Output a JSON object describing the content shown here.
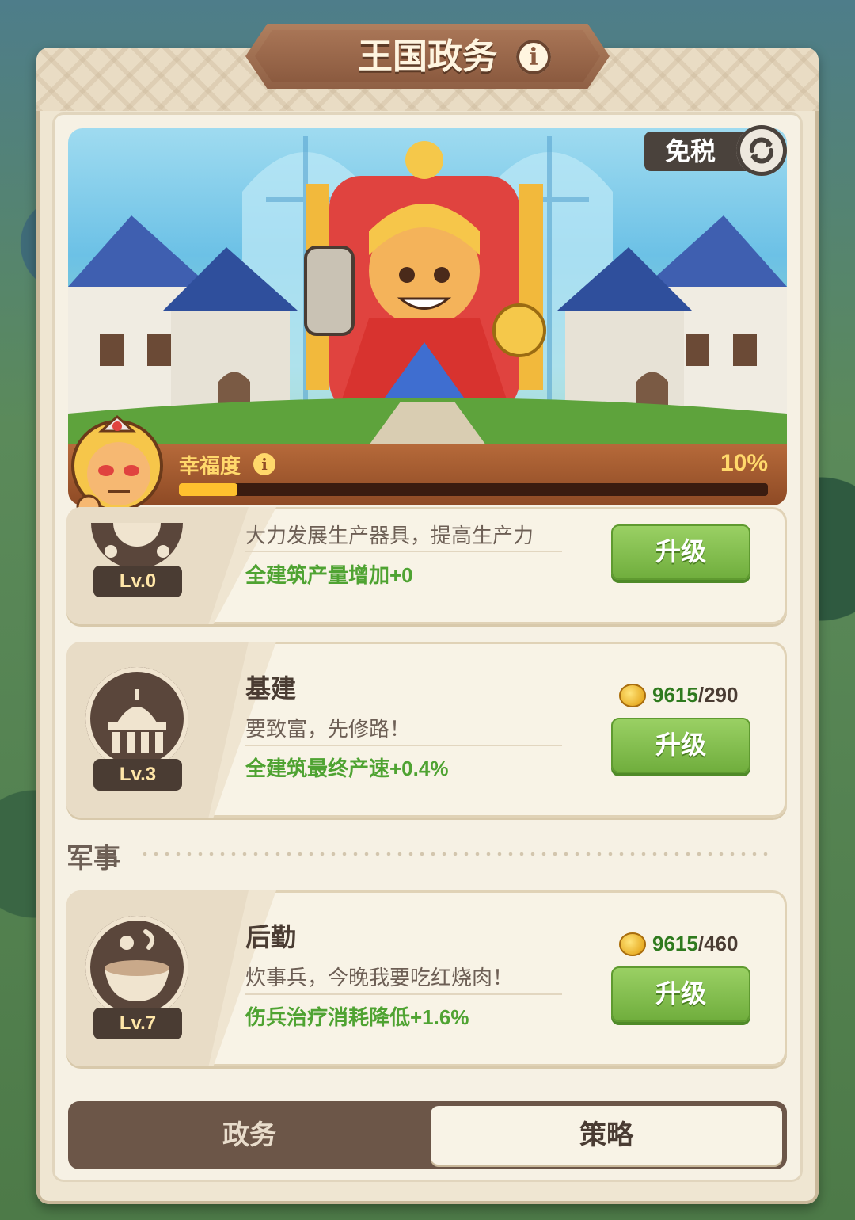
{
  "header": {
    "title": "王国政务",
    "info_icon": "info-icon"
  },
  "banner": {
    "tax_free_label": "免税",
    "refresh_icon": "refresh-icon",
    "happiness_label": "幸福度",
    "happiness_percent_text": "10%",
    "happiness_fraction": 0.1
  },
  "cards": [
    {
      "level": "Lv.0",
      "icon": "gear-icon",
      "desc": "大力发展生产器具，提高生产力",
      "effect": "全建筑产量增加+0",
      "upgrade_label": "升级"
    },
    {
      "title": "基建",
      "level": "Lv.3",
      "icon": "palace-icon",
      "desc": "要致富，先修路！",
      "effect": "全建筑最终产速+0.4%",
      "cost_have": "9615",
      "cost_need": "/290",
      "upgrade_label": "升级"
    },
    {
      "title": "后勤",
      "level": "Lv.7",
      "icon": "soup-bowl-icon",
      "desc": "炊事兵，今晚我要吃红烧肉！",
      "effect": "伤兵治疗消耗降低+1.6%",
      "cost_have": "9615",
      "cost_need": "/460",
      "upgrade_label": "升级"
    }
  ],
  "section_military": "军事",
  "tabs": [
    {
      "label": "政务",
      "active": false
    },
    {
      "label": "策略",
      "active": true
    }
  ],
  "colors": {
    "accent_green": "#6fad3c",
    "panel_bg": "#f6f1e4",
    "happiness_fill": "#ffc12e",
    "effect_text": "#4fa332"
  }
}
